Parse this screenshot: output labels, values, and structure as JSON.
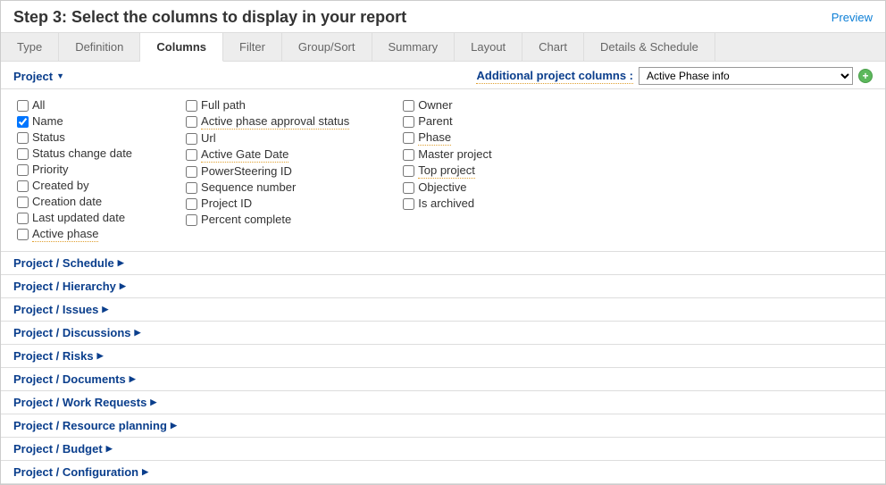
{
  "header": {
    "title": "Step 3: Select the columns to display in your report",
    "preview": "Preview"
  },
  "tabs": [
    "Type",
    "Definition",
    "Columns",
    "Filter",
    "Group/Sort",
    "Summary",
    "Layout",
    "Chart",
    "Details & Schedule"
  ],
  "activeTab": "Columns",
  "projectDropdown": "Project",
  "additionalColumns": {
    "label": "Additional project columns :",
    "selected": "Active Phase info"
  },
  "checkColumns": [
    [
      {
        "label": "All",
        "checked": false,
        "underlined": false
      },
      {
        "label": "Name",
        "checked": true,
        "underlined": false
      },
      {
        "label": "Status",
        "checked": false,
        "underlined": false
      },
      {
        "label": "Status change date",
        "checked": false,
        "underlined": false
      },
      {
        "label": "Priority",
        "checked": false,
        "underlined": false
      },
      {
        "label": "Created by",
        "checked": false,
        "underlined": false
      },
      {
        "label": "Creation date",
        "checked": false,
        "underlined": false
      },
      {
        "label": "Last updated date",
        "checked": false,
        "underlined": false
      },
      {
        "label": "Active phase",
        "checked": false,
        "underlined": true
      }
    ],
    [
      {
        "label": "Full path",
        "checked": false,
        "underlined": false
      },
      {
        "label": "Active phase approval status",
        "checked": false,
        "underlined": true
      },
      {
        "label": "Url",
        "checked": false,
        "underlined": false
      },
      {
        "label": "Active Gate Date",
        "checked": false,
        "underlined": true
      },
      {
        "label": "PowerSteering ID",
        "checked": false,
        "underlined": false
      },
      {
        "label": "Sequence number",
        "checked": false,
        "underlined": false
      },
      {
        "label": "Project ID",
        "checked": false,
        "underlined": false
      },
      {
        "label": "Percent complete",
        "checked": false,
        "underlined": false
      }
    ],
    [
      {
        "label": "Owner",
        "checked": false,
        "underlined": false
      },
      {
        "label": "Parent",
        "checked": false,
        "underlined": false
      },
      {
        "label": "Phase",
        "checked": false,
        "underlined": true
      },
      {
        "label": "Master project",
        "checked": false,
        "underlined": false
      },
      {
        "label": "Top project",
        "checked": false,
        "underlined": true
      },
      {
        "label": "Objective",
        "checked": false,
        "underlined": false
      },
      {
        "label": "Is archived",
        "checked": false,
        "underlined": false
      }
    ]
  ],
  "sections": [
    "Project / Schedule",
    "Project / Hierarchy",
    "Project / Issues",
    "Project / Discussions",
    "Project / Risks",
    "Project / Documents",
    "Project / Work Requests",
    "Project / Resource planning",
    "Project / Budget",
    "Project / Configuration"
  ]
}
